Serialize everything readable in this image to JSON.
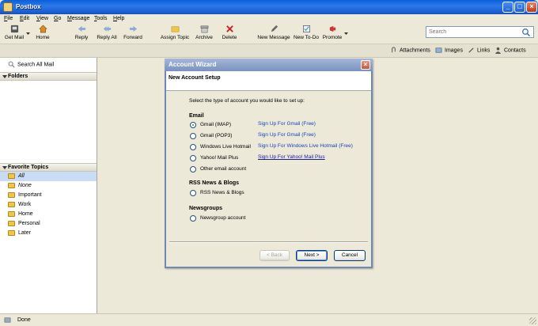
{
  "window": {
    "title": "Postbox"
  },
  "menu": [
    "File",
    "Edit",
    "View",
    "Go",
    "Message",
    "Tools",
    "Help"
  ],
  "toolbar": {
    "get_mail": "Get Mail",
    "home": "Home",
    "reply": "Reply",
    "reply_all": "Reply All",
    "forward": "Forward",
    "assign_topic": "Assign Topic",
    "archive": "Archive",
    "delete": "Delete",
    "new_message": "New Message",
    "new_todo": "New To-Do",
    "promote": "Promote",
    "search_placeholder": "Search"
  },
  "subbar": {
    "attachments": "Attachments",
    "images": "Images",
    "links": "Links",
    "contacts": "Contacts"
  },
  "sidebar": {
    "search_all": "Search All Mail",
    "folders_header": "Folders",
    "topics_header": "Favorite Topics",
    "topics": [
      "All",
      "None",
      "Important",
      "Work",
      "Home",
      "Personal",
      "Later"
    ]
  },
  "dialog": {
    "title": "Account Wizard",
    "header": "New Account Setup",
    "prompt": "Select the type of account you would like to set up:",
    "email_section": "Email",
    "options": {
      "gmail_imap": "Gmail (IMAP)",
      "gmail_pop3": "Gmail (POP3)",
      "hotmail": "Windows Live Hotmail",
      "yahoo": "Yahoo! Mail Plus",
      "other_email": "Other email account",
      "rss": "RSS News & Blogs",
      "newsgroup": "Newsgroup account"
    },
    "links": {
      "gmail_imap": "Sign Up For Gmail (Free)",
      "gmail_pop3": "Sign Up For Gmail (Free)",
      "hotmail": "Sign Up For Windows Live Hotmail (Free)",
      "yahoo": "Sign Up For Yahoo! Mail Plus"
    },
    "rss_section": "RSS News & Blogs",
    "newsgroups_section": "Newsgroups",
    "buttons": {
      "back": "< Back",
      "next": "Next >",
      "cancel": "Cancel"
    }
  },
  "status": {
    "text": "Done"
  }
}
